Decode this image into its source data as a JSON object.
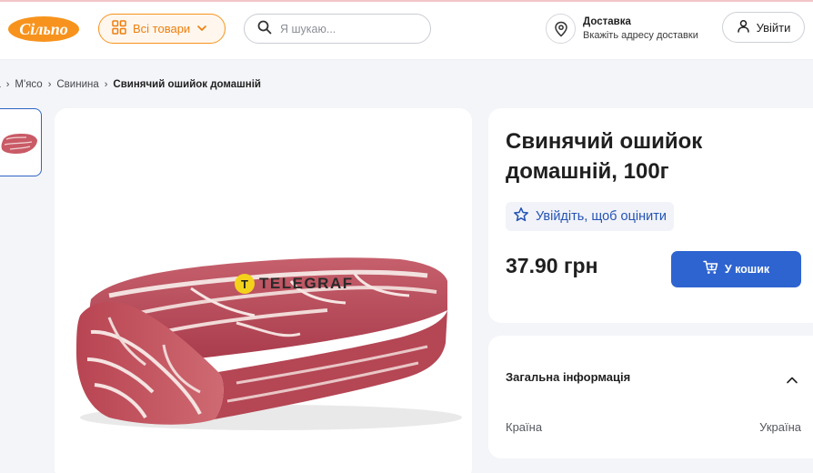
{
  "header": {
    "logo_text": "Сільпо",
    "all_goods_label": "Всі товари",
    "search_placeholder": "Я шукаю...",
    "delivery_title": "Доставка",
    "delivery_subtitle": "Вкажіть адресу доставки",
    "login_label": "Увійти"
  },
  "breadcrumb": {
    "items": [
      "на",
      "М'ясо",
      "Свинина"
    ],
    "current": "Свинячий ошийок домашній"
  },
  "image": {
    "watermark_letter": "T",
    "watermark_text": "TELEGRAF"
  },
  "product": {
    "title": "Свинячий ошийок домашній, 100г",
    "rate_label": "Увійдіть, щоб оцінити",
    "price": "37.90 грн",
    "cart_label": "У кошик"
  },
  "general_info": {
    "title": "Загальна інформація",
    "rows": [
      {
        "key": "Країна",
        "value": "Україна"
      }
    ]
  },
  "colors": {
    "brand_orange": "#f7931d",
    "accent_blue": "#2e64d0",
    "page_bg": "#f4f5f8"
  },
  "icons": [
    "grid-icon",
    "chevron-down-icon",
    "search-icon",
    "location-pin-icon",
    "user-icon",
    "star-icon",
    "cart-icon",
    "chevron-up-icon",
    "breadcrumb-chevron-icon"
  ]
}
